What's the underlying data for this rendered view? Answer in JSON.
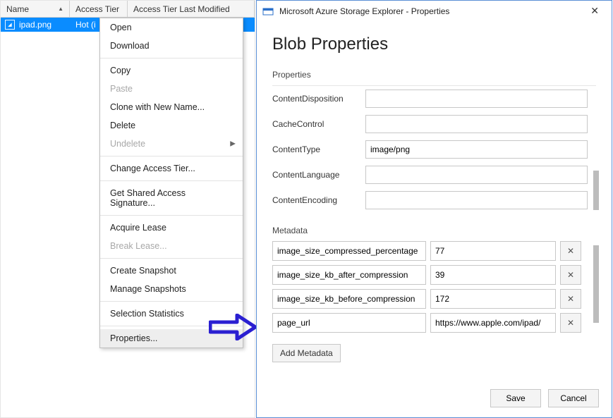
{
  "grid": {
    "columns": {
      "name": "Name",
      "tier": "Access Tier",
      "modified": "Access Tier Last Modified"
    },
    "row": {
      "filename": "ipad.png",
      "tier": "Hot (i"
    }
  },
  "context_menu": {
    "open": "Open",
    "download": "Download",
    "copy": "Copy",
    "paste": "Paste",
    "clone": "Clone with New Name...",
    "delete": "Delete",
    "undelete": "Undelete",
    "change_tier": "Change Access Tier...",
    "get_sas": "Get Shared Access Signature...",
    "acquire_lease": "Acquire Lease",
    "break_lease": "Break Lease...",
    "create_snapshot": "Create Snapshot",
    "manage_snapshots": "Manage Snapshots",
    "selection_stats": "Selection Statistics",
    "properties": "Properties..."
  },
  "dialog": {
    "title": "Microsoft Azure Storage Explorer - Properties",
    "heading": "Blob Properties",
    "sections": {
      "properties": "Properties",
      "metadata": "Metadata"
    },
    "properties": {
      "ContentDisposition": {
        "label": "ContentDisposition",
        "value": ""
      },
      "CacheControl": {
        "label": "CacheControl",
        "value": ""
      },
      "ContentType": {
        "label": "ContentType",
        "value": "image/png"
      },
      "ContentLanguage": {
        "label": "ContentLanguage",
        "value": ""
      },
      "ContentEncoding": {
        "label": "ContentEncoding",
        "value": ""
      }
    },
    "metadata": [
      {
        "key": "image_size_compressed_percentage",
        "value": "77"
      },
      {
        "key": "image_size_kb_after_compression",
        "value": "39"
      },
      {
        "key": "image_size_kb_before_compression",
        "value": "172"
      },
      {
        "key": "page_url",
        "value": "https://www.apple.com/ipad/"
      }
    ],
    "buttons": {
      "add_metadata": "Add Metadata",
      "save": "Save",
      "cancel": "Cancel"
    }
  }
}
